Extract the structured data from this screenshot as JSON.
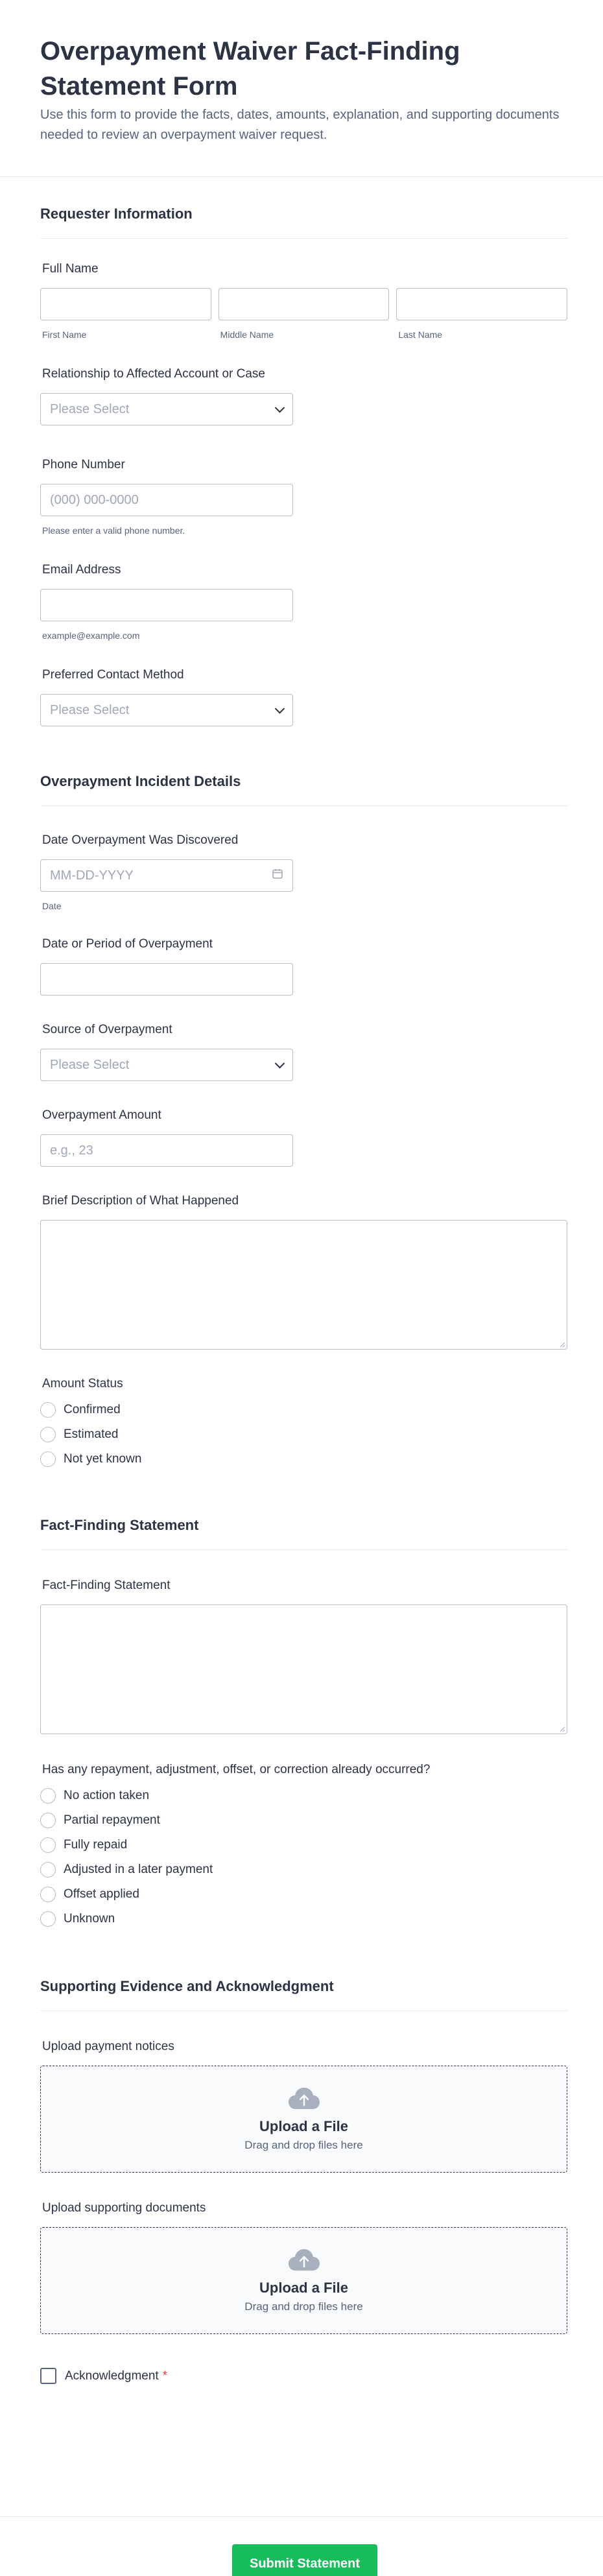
{
  "header": {
    "title": "Overpayment Waiver Fact-Finding Statement Form",
    "subtitle": "Use this form to provide the facts, dates, amounts, explanation, and supporting documents needed to review an overpayment waiver request."
  },
  "sections": {
    "requester": {
      "title": "Requester Information",
      "full_name": {
        "label": "Full Name",
        "first": "First Name",
        "middle": "Middle Name",
        "last": "Last Name"
      },
      "relationship": {
        "label": "Relationship to Affected Account or Case",
        "placeholder": "Please Select"
      },
      "phone": {
        "label": "Phone Number",
        "placeholder": "(000) 000-0000",
        "hint": "Please enter a valid phone number."
      },
      "email": {
        "label": "Email Address",
        "hint": "example@example.com"
      },
      "contact_method": {
        "label": "Preferred Contact Method",
        "placeholder": "Please Select"
      }
    },
    "incident": {
      "title": "Overpayment Incident Details",
      "date_discovered": {
        "label": "Date Overpayment Was Discovered",
        "placeholder": "MM-DD-YYYY",
        "hint": "Date"
      },
      "date_period": {
        "label": "Date or Period of Overpayment"
      },
      "source": {
        "label": "Source of Overpayment",
        "placeholder": "Please Select"
      },
      "amount": {
        "label": "Overpayment Amount",
        "placeholder": "e.g., 23"
      },
      "description": {
        "label": "Brief Description of What Happened"
      },
      "amount_status": {
        "label": "Amount Status",
        "options": [
          "Confirmed",
          "Estimated",
          "Not yet known"
        ]
      }
    },
    "statement": {
      "title": "Fact-Finding Statement",
      "statement_field": {
        "label": "Fact-Finding Statement"
      },
      "repayment": {
        "label": "Has any repayment, adjustment, offset, or correction already occurred?",
        "options": [
          "No action taken",
          "Partial repayment",
          "Fully repaid",
          "Adjusted in a later payment",
          "Offset applied",
          "Unknown"
        ]
      }
    },
    "evidence": {
      "title": "Supporting Evidence and Acknowledgment",
      "payment_notices": {
        "label": "Upload payment notices",
        "button": "Upload a File",
        "hint": "Drag and drop files here"
      },
      "supporting_docs": {
        "label": "Upload supporting documents",
        "button": "Upload a File",
        "hint": "Drag and drop files here"
      },
      "acknowledgment": {
        "label": "Acknowledgment",
        "required_mark": "*"
      }
    }
  },
  "footer": {
    "submit_label": "Submit Statement"
  },
  "colors": {
    "accent": "#18bd5b",
    "text": "#2c3345",
    "muted": "#57647e",
    "border": "#b8bdc9",
    "required": "#f23a3c"
  }
}
